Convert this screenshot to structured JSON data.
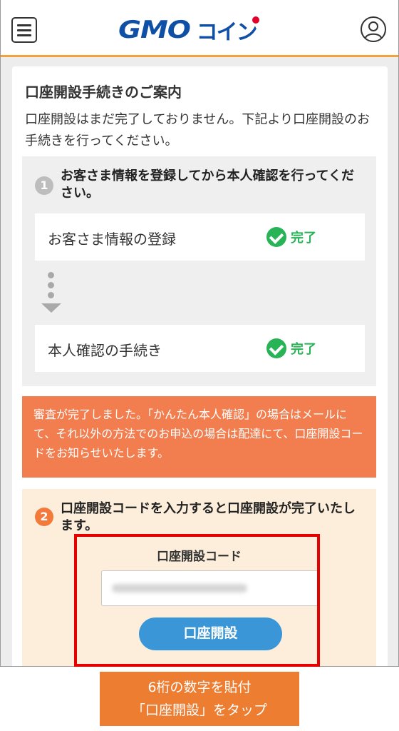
{
  "header": {
    "logo_text_latin": "GMO",
    "logo_text_kana": "コイン",
    "accent_color": "#f3a13c",
    "brand_color": "#0f4fa6"
  },
  "card": {
    "title": "口座開設手続きのご案内",
    "description": "口座開設はまだ完了しておりません。下記より口座開設のお手続きを行ってください。",
    "step1": {
      "number": "1",
      "text": "お客さま情報を登録してから本人確認を行ってください。",
      "tasks": [
        {
          "label": "お客さま情報の登録",
          "status": "完了"
        },
        {
          "label": "本人確認の手続き",
          "status": "完了"
        }
      ]
    },
    "notice": "審査が完了しました。「かんたん本人確認」の場合はメールにて、それ以外の方法でのお申込の場合は配達にて、口座開設コードをお知らせいたします。",
    "step2": {
      "number": "2",
      "text": "口座開設コードを入力すると口座開設が完了いたします。",
      "code_label": "口座開設コード",
      "code_value": "",
      "submit_label": "口座開設"
    }
  },
  "instruction": {
    "line1": "6桁の数字を貼付",
    "line2": "「口座開設」をタップ"
  },
  "colors": {
    "done_green": "#27b356",
    "notice_orange": "#f27e4f",
    "button_blue": "#3b96d7",
    "highlight_red": "#e60000",
    "instruction_orange": "#ed7d31"
  }
}
